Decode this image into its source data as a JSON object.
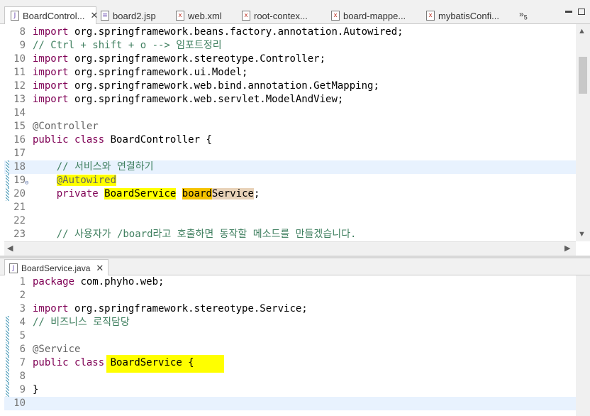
{
  "top_tabs": [
    {
      "label": "BoardControl...",
      "icon": "java-file-icon",
      "active": true
    },
    {
      "label": "board2.jsp",
      "icon": "jsp-file-icon"
    },
    {
      "label": "web.xml",
      "icon": "xml-file-icon"
    },
    {
      "label": "root-contex...",
      "icon": "xml-file-icon"
    },
    {
      "label": "board-mappe...",
      "icon": "xml-file-icon"
    },
    {
      "label": "mybatisConfi...",
      "icon": "xml-file-icon"
    }
  ],
  "overflow_count": "5",
  "close_glyph": "✕",
  "editor1": {
    "lines": [
      {
        "n": "8",
        "code": "import org.springframework.beans.factory.annotation.Autowired;"
      },
      {
        "n": "9",
        "code": "// Ctrl + shift + o --> 임포트정리"
      },
      {
        "n": "10",
        "code": "import org.springframework.stereotype.Controller;"
      },
      {
        "n": "11",
        "code": "import org.springframework.ui.Model;"
      },
      {
        "n": "12",
        "code": "import org.springframework.web.bind.annotation.GetMapping;"
      },
      {
        "n": "13",
        "code": "import org.springframework.web.servlet.ModelAndView;"
      },
      {
        "n": "14",
        "code": ""
      },
      {
        "n": "15",
        "code": "@Controller"
      },
      {
        "n": "16",
        "code": "public class BoardController {"
      },
      {
        "n": "17",
        "code": ""
      },
      {
        "n": "18",
        "code": "    // 서비스와 연결하기"
      },
      {
        "n": "19",
        "code": "    @Autowired"
      },
      {
        "n": "20",
        "code": "    private BoardService boardService;"
      },
      {
        "n": "21",
        "code": ""
      },
      {
        "n": "22",
        "code": ""
      },
      {
        "n": "23",
        "code": "    // 사용자가 /board라고 호출하면 동작할 메소드를 만들겠습니다."
      }
    ]
  },
  "bottom_tab": {
    "label": "BoardService.java",
    "icon": "java-file-icon"
  },
  "editor2": {
    "lines": [
      {
        "n": "1",
        "code": "package com.phyho.web;"
      },
      {
        "n": "2",
        "code": ""
      },
      {
        "n": "3",
        "code": "import org.springframework.stereotype.Service;"
      },
      {
        "n": "4",
        "code": "// 비즈니스 로직담당"
      },
      {
        "n": "5",
        "code": ""
      },
      {
        "n": "6",
        "code": "@Service"
      },
      {
        "n": "7",
        "code": "public class BoardService {"
      },
      {
        "n": "8",
        "code": ""
      },
      {
        "n": "9",
        "code": "}"
      },
      {
        "n": "10",
        "code": ""
      }
    ]
  },
  "colors": {
    "keyword": "#7f0055",
    "comment": "#3f7f5f",
    "annotation": "#646464",
    "highlight": "#ffff00",
    "current_line": "#e8f2fe"
  }
}
